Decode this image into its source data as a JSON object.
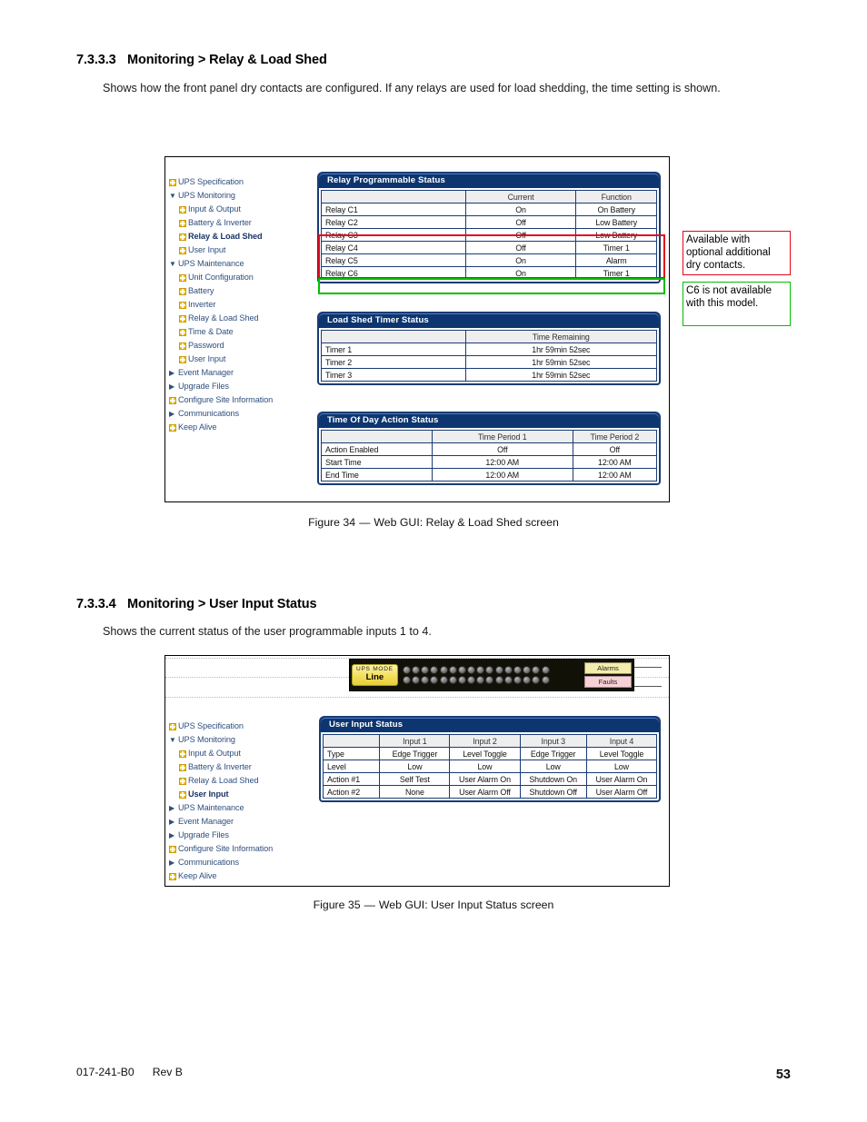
{
  "doc": {
    "footer_code": "017-241-B0",
    "footer_rev": "Rev B",
    "page_number": "53"
  },
  "section_1": {
    "number": "7.3.3.3",
    "title": "Monitoring > Relay & Load Shed",
    "body": "Shows how the front panel dry contacts are configured. If any relays are used for load shedding, the time setting is shown.",
    "figure_caption_label": "Figure 34",
    "figure_caption_dash": "—",
    "figure_caption_text": "Web GUI: Relay & Load Shed screen"
  },
  "section_2": {
    "number": "7.3.3.4",
    "title": "Monitoring > User Input Status",
    "body": "Shows the current status of the user programmable inputs 1 to 4.",
    "figure_caption_label": "Figure 35",
    "figure_caption_dash": "—",
    "figure_caption_text": "Web GUI: User Input Status screen"
  },
  "figure34": {
    "nav": [
      {
        "label": "UPS Specification",
        "icon": "page-icon",
        "indent": 0,
        "bold": false,
        "marker": "icon"
      },
      {
        "label": "UPS Monitoring",
        "icon": "triangle-down-icon",
        "indent": 0,
        "bold": false,
        "marker": "expanded"
      },
      {
        "label": "Input & Output",
        "icon": "page-icon",
        "indent": 1,
        "bold": false,
        "marker": "icon"
      },
      {
        "label": "Battery & Inverter",
        "icon": "page-icon",
        "indent": 1,
        "bold": false,
        "marker": "icon"
      },
      {
        "label": "Relay & Load Shed",
        "icon": "page-icon",
        "indent": 1,
        "bold": true,
        "marker": "icon"
      },
      {
        "label": "User Input",
        "icon": "page-icon",
        "indent": 1,
        "bold": false,
        "marker": "icon"
      },
      {
        "label": "UPS Maintenance",
        "icon": "triangle-down-icon",
        "indent": 0,
        "bold": false,
        "marker": "expanded"
      },
      {
        "label": "Unit Configuration",
        "icon": "page-icon",
        "indent": 1,
        "bold": false,
        "marker": "icon"
      },
      {
        "label": "Battery",
        "icon": "page-icon",
        "indent": 1,
        "bold": false,
        "marker": "icon"
      },
      {
        "label": "Inverter",
        "icon": "page-icon",
        "indent": 1,
        "bold": false,
        "marker": "icon"
      },
      {
        "label": "Relay & Load Shed",
        "icon": "page-icon",
        "indent": 1,
        "bold": false,
        "marker": "icon"
      },
      {
        "label": "Time & Date",
        "icon": "page-icon",
        "indent": 1,
        "bold": false,
        "marker": "icon"
      },
      {
        "label": "Password",
        "icon": "page-icon",
        "indent": 1,
        "bold": false,
        "marker": "icon"
      },
      {
        "label": "User Input",
        "icon": "page-icon",
        "indent": 1,
        "bold": false,
        "marker": "icon"
      },
      {
        "label": "Event Manager",
        "icon": "triangle-right-icon",
        "indent": 0,
        "bold": false,
        "marker": "collapsed"
      },
      {
        "label": "Upgrade Files",
        "icon": "triangle-right-icon",
        "indent": 0,
        "bold": false,
        "marker": "collapsed"
      },
      {
        "label": "Configure Site Information",
        "icon": "page-icon",
        "indent": 0,
        "bold": false,
        "marker": "icon"
      },
      {
        "label": "Communications",
        "icon": "triangle-right-icon",
        "indent": 0,
        "bold": false,
        "marker": "collapsed"
      },
      {
        "label": "Keep Alive",
        "icon": "page-icon",
        "indent": 0,
        "bold": false,
        "marker": "icon"
      }
    ],
    "relay_panel": {
      "title": "Relay Programmable Status",
      "headers": [
        "",
        "Current",
        "Function"
      ],
      "rows": [
        [
          "Relay C1",
          "On",
          "On Battery"
        ],
        [
          "Relay C2",
          "Off",
          "Low Battery"
        ],
        [
          "Relay C3",
          "Off",
          "Low Battery"
        ],
        [
          "Relay C4",
          "Off",
          "Timer 1"
        ],
        [
          "Relay C5",
          "On",
          "Alarm"
        ],
        [
          "Relay C6",
          "On",
          "Timer 1"
        ]
      ]
    },
    "timer_panel": {
      "title": "Load Shed Timer Status",
      "headers": [
        "",
        "Time Remaining"
      ],
      "rows": [
        [
          "Timer 1",
          "1hr 59min 52sec"
        ],
        [
          "Timer 2",
          "1hr 59min 52sec"
        ],
        [
          "Timer 3",
          "1hr 59min 52sec"
        ]
      ]
    },
    "tod_panel": {
      "title": "Time Of Day Action Status",
      "headers": [
        "",
        "Time Period 1",
        "Time Period 2"
      ],
      "rows": [
        [
          "Action Enabled",
          "Off",
          "Off"
        ],
        [
          "Start Time",
          "12:00 AM",
          "12:00 AM"
        ],
        [
          "End Time",
          "12:00 AM",
          "12:00 AM"
        ]
      ]
    },
    "callouts": [
      {
        "text": "Available with optional additional dry contacts.",
        "color": "#e2061b"
      },
      {
        "text": "C6 is not available with this model.",
        "color": "#00c000"
      }
    ],
    "highlights": [
      {
        "name": "red-highlight-relay-c3-c5",
        "color": "#e2061b"
      },
      {
        "name": "green-highlight-relay-c6",
        "color": "#00c000"
      }
    ]
  },
  "figure35": {
    "front_panel": {
      "ups_mode_label": "UPS MODE",
      "ups_mode_value": "Line",
      "alarms_label": "Alarms",
      "faults_label": "Faults",
      "led_rows": 2,
      "leds_per_row": 16
    },
    "nav": [
      {
        "label": "UPS Specification",
        "icon": "page-icon",
        "indent": 0,
        "bold": false,
        "marker": "icon"
      },
      {
        "label": "UPS Monitoring",
        "icon": "triangle-down-icon",
        "indent": 0,
        "bold": false,
        "marker": "expanded"
      },
      {
        "label": "Input & Output",
        "icon": "page-icon",
        "indent": 1,
        "bold": false,
        "marker": "icon"
      },
      {
        "label": "Battery & Inverter",
        "icon": "page-icon",
        "indent": 1,
        "bold": false,
        "marker": "icon"
      },
      {
        "label": "Relay & Load Shed",
        "icon": "page-icon",
        "indent": 1,
        "bold": false,
        "marker": "icon"
      },
      {
        "label": "User Input",
        "icon": "page-icon",
        "indent": 1,
        "bold": true,
        "marker": "icon"
      },
      {
        "label": "UPS Maintenance",
        "icon": "triangle-right-icon",
        "indent": 0,
        "bold": false,
        "marker": "collapsed"
      },
      {
        "label": "Event Manager",
        "icon": "triangle-right-icon",
        "indent": 0,
        "bold": false,
        "marker": "collapsed"
      },
      {
        "label": "Upgrade Files",
        "icon": "triangle-right-icon",
        "indent": 0,
        "bold": false,
        "marker": "collapsed"
      },
      {
        "label": "Configure Site Information",
        "icon": "page-icon",
        "indent": 0,
        "bold": false,
        "marker": "icon"
      },
      {
        "label": "Communications",
        "icon": "triangle-right-icon",
        "indent": 0,
        "bold": false,
        "marker": "collapsed"
      },
      {
        "label": "Keep Alive",
        "icon": "page-icon",
        "indent": 0,
        "bold": false,
        "marker": "icon"
      }
    ],
    "user_input_panel": {
      "title": "User Input Status",
      "headers": [
        "",
        "Input 1",
        "Input 2",
        "Input 3",
        "Input 4"
      ],
      "rows": [
        [
          "Type",
          "Edge Trigger",
          "Level Toggle",
          "Edge Trigger",
          "Level Toggle"
        ],
        [
          "Level",
          "Low",
          "Low",
          "Low",
          "Low"
        ],
        [
          "Action #1",
          "Self Test",
          "User Alarm On",
          "Shutdown On",
          "User Alarm On"
        ],
        [
          "Action #2",
          "None",
          "User Alarm Off",
          "Shutdown Off",
          "User Alarm Off"
        ]
      ]
    }
  }
}
